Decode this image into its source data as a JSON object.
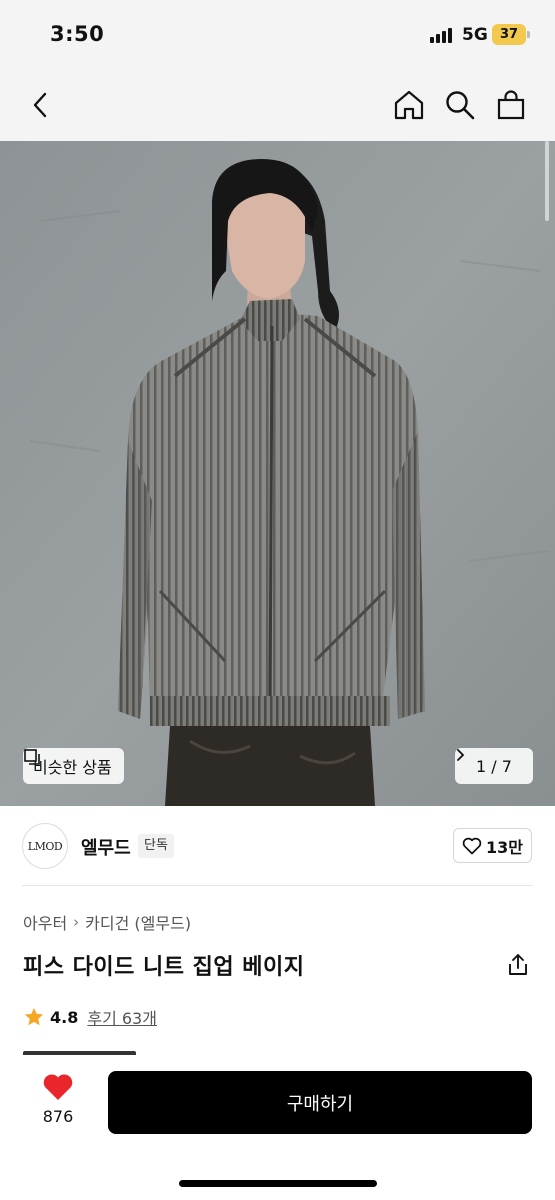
{
  "status_bar": {
    "time": "3:50",
    "network": "5G",
    "battery": "37"
  },
  "nav": {
    "icons": [
      "chevron-left-icon",
      "home-icon",
      "search-icon",
      "shopping-bag-icon"
    ]
  },
  "gallery": {
    "similar_label": "비슷한 상품",
    "counter": "1 / 7"
  },
  "brand": {
    "logo_text": "LMOD",
    "name": "엘무드",
    "badge": "단독",
    "likes": "13만"
  },
  "breadcrumb": {
    "level1": "아우터",
    "level2": "카디건 (엘무드)"
  },
  "product": {
    "title": "피스 다이드 니트 집업 베이지"
  },
  "rating": {
    "score": "4.8",
    "reviews": "후기 63개"
  },
  "bottom": {
    "wish_count": "876",
    "buy_label": "구매하기"
  },
  "colors": {
    "accent_heart": "#e8262b",
    "star": "#f5a623",
    "button": "#000000",
    "battery": "#f2c94c"
  }
}
